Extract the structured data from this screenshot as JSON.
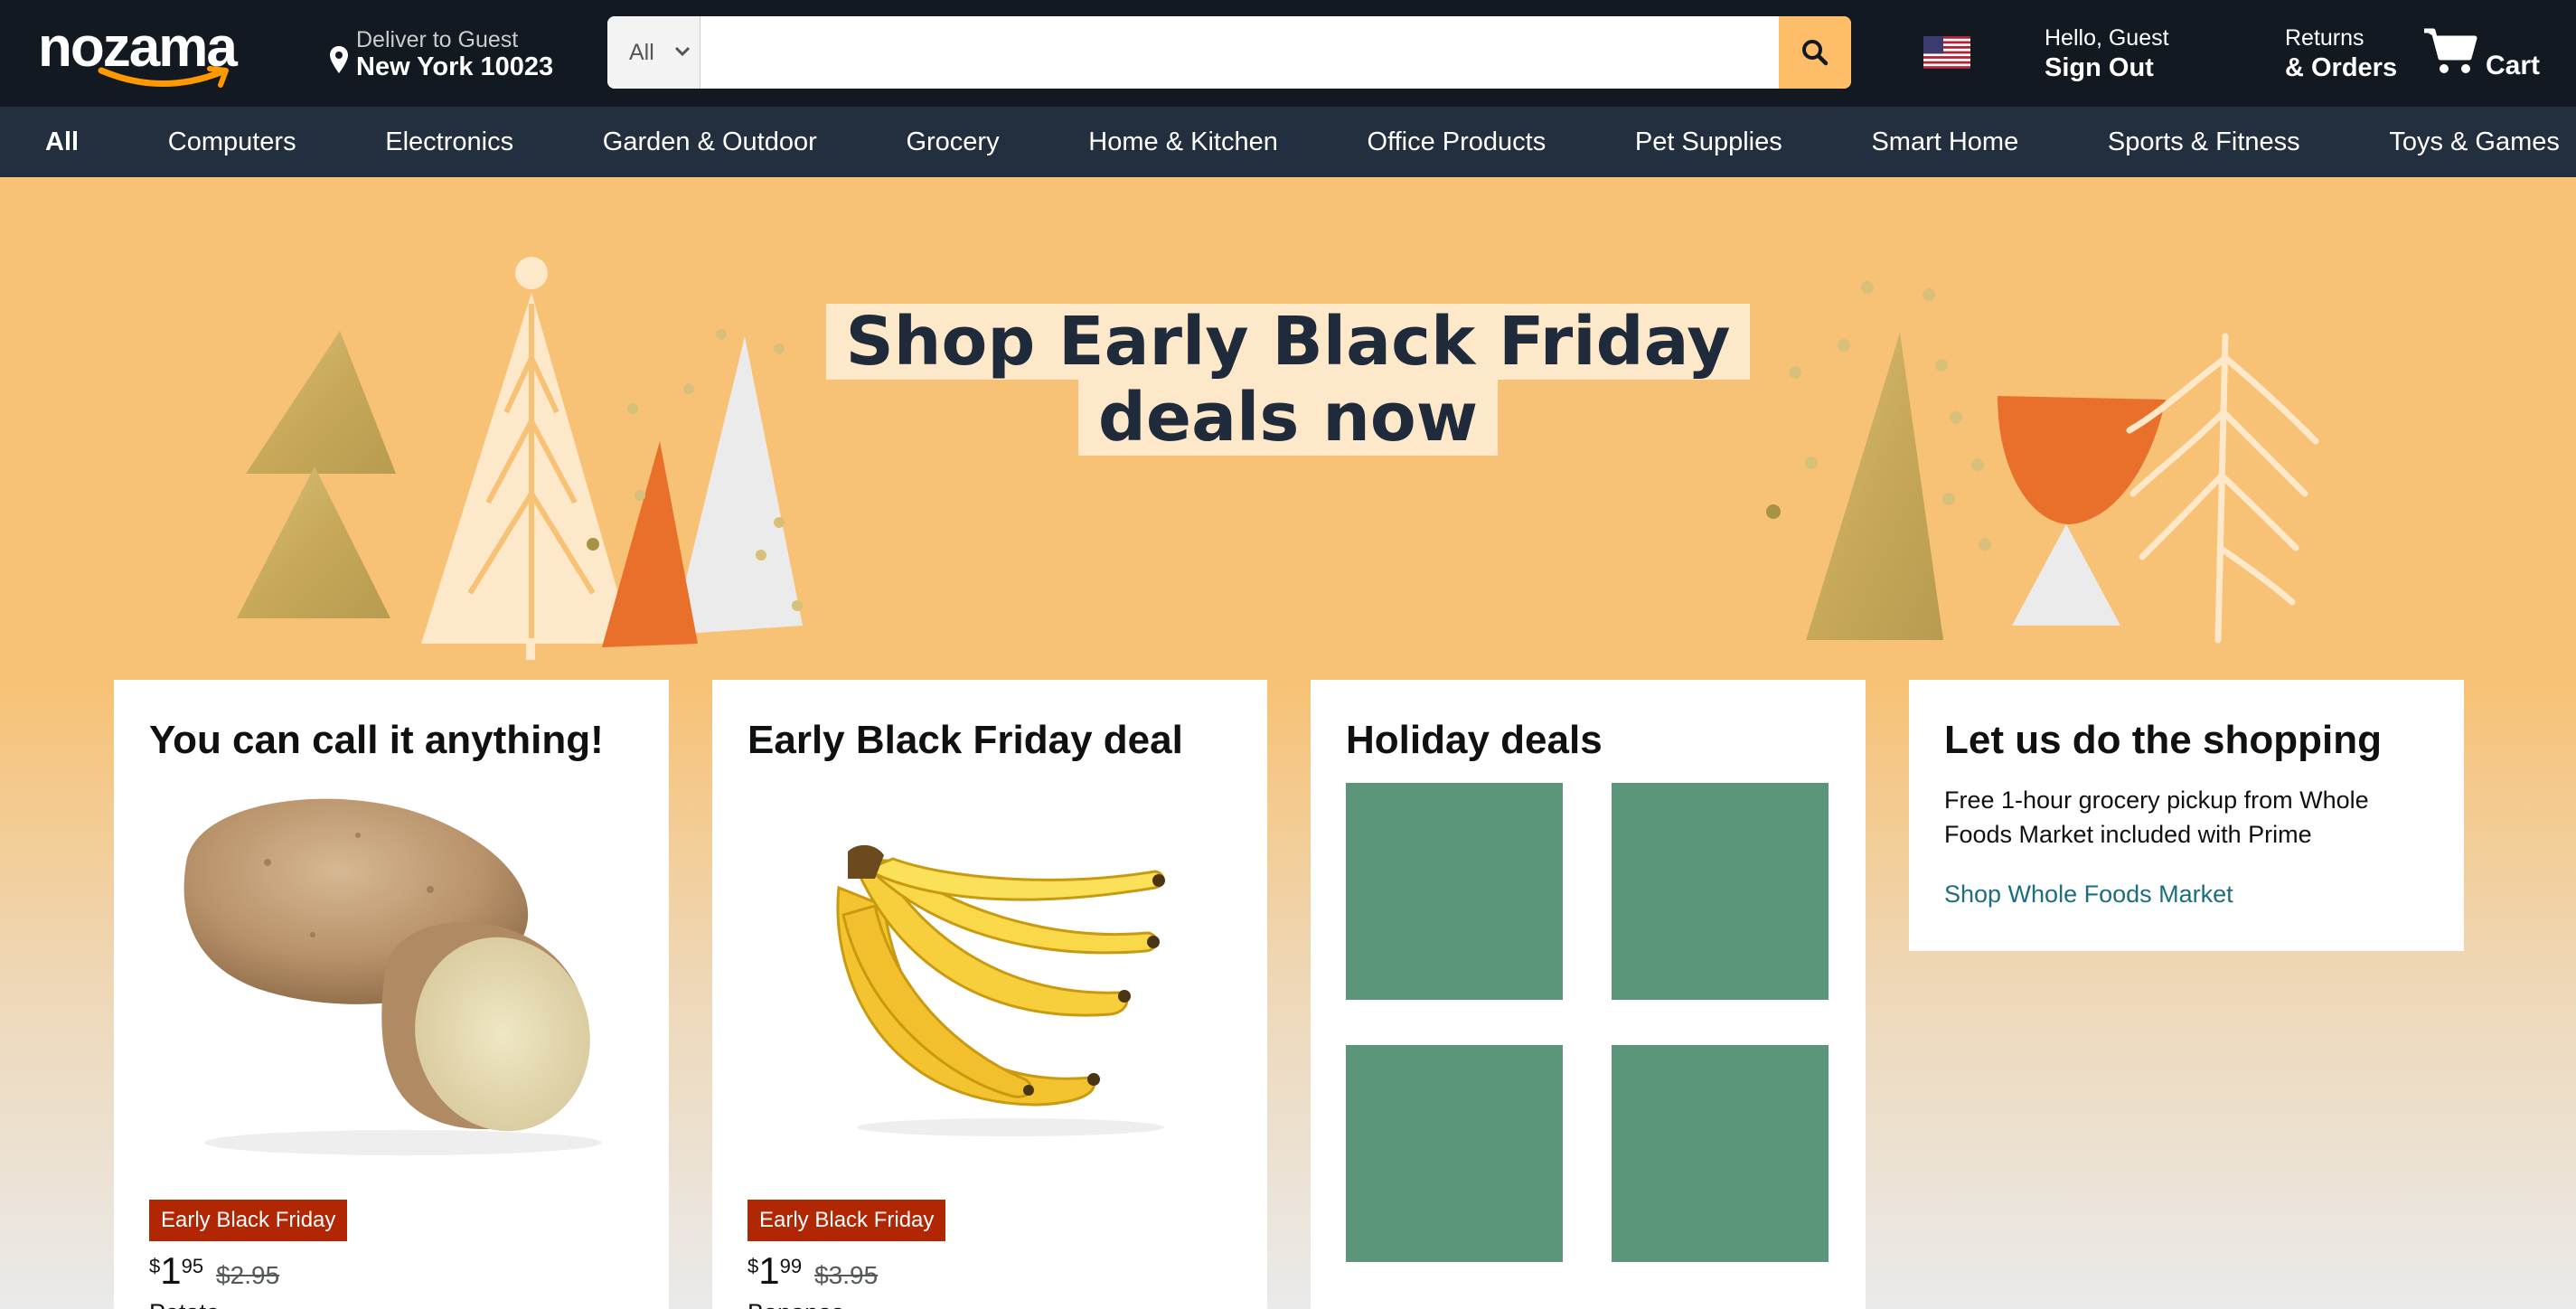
{
  "header": {
    "logo_text": "nozama",
    "deliver_line1": "Deliver to Guest",
    "deliver_line2": "New York 10023",
    "search_scope": "All",
    "search_placeholder": "",
    "search_icon": "search-icon",
    "flag_icon": "us-flag-icon",
    "account_line1": "Hello, Guest",
    "account_line2": "Sign Out",
    "returns_line1": "Returns",
    "returns_line2": "& Orders",
    "cart_label": "Cart",
    "cart_icon": "cart-icon"
  },
  "nav": {
    "items": [
      "All",
      "Computers",
      "Electronics",
      "Garden & Outdoor",
      "Grocery",
      "Home & Kitchen",
      "Office Products",
      "Pet Supplies",
      "Smart Home",
      "Sports & Fitness",
      "Toys & Games"
    ]
  },
  "hero": {
    "headline_line1": "Shop Early Black Friday",
    "headline_line2": "deals now"
  },
  "cards": [
    {
      "title": "You can call it anything!",
      "badge": "Early Black Friday",
      "price_currency": "$",
      "price_whole": "1",
      "price_fraction": "95",
      "price_was": "$2.95",
      "product_name": "Potato"
    },
    {
      "title": "Early Black Friday deal",
      "badge": "Early Black Friday",
      "price_currency": "$",
      "price_whole": "1",
      "price_fraction": "99",
      "price_was": "$3.95",
      "product_name": "Bananas"
    },
    {
      "title": "Holiday deals",
      "tile_color": "#5b957a"
    },
    {
      "title": "Let us do the shopping",
      "description": "Free 1-hour grocery pickup from Whole Foods Market included with Prime",
      "link": "Shop Whole Foods Market"
    }
  ],
  "colors": {
    "header_bg": "#131921",
    "nav_bg": "#232f3e",
    "search_button": "#febd69",
    "hero_bg": "#f7c276",
    "badge_bg": "#b12704",
    "link": "#1b6e80"
  }
}
